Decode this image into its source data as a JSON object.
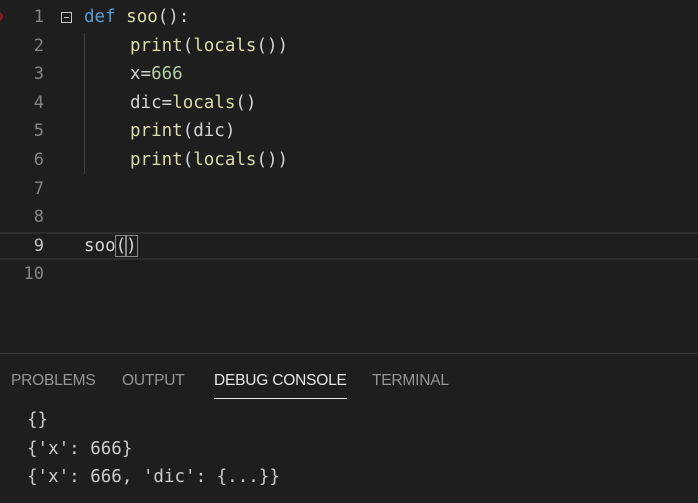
{
  "editor": {
    "lines": [
      {
        "num": "1",
        "kw": "def",
        "name": "soo",
        "rest": "():"
      },
      {
        "num": "2",
        "fn": "print",
        "rest": "(",
        "fn2": "locals",
        "rest2": "())"
      },
      {
        "num": "3",
        "a": "x=",
        "n": "666"
      },
      {
        "num": "4",
        "a": "dic=",
        "fn": "locals",
        "rest": "()"
      },
      {
        "num": "5",
        "fn": "print",
        "rest": "(dic)"
      },
      {
        "num": "6",
        "fn": "print",
        "rest": "(",
        "fn2": "locals",
        "rest2": "())"
      },
      {
        "num": "7"
      },
      {
        "num": "8"
      },
      {
        "num": "9",
        "fn": "soo",
        "open": "(",
        "close": ")"
      },
      {
        "num": "10"
      }
    ]
  },
  "panel": {
    "tabs": [
      {
        "label": "PROBLEMS"
      },
      {
        "label": "OUTPUT"
      },
      {
        "label": "DEBUG CONSOLE"
      },
      {
        "label": "TERMINAL"
      }
    ],
    "active_tab": "DEBUG CONSOLE",
    "console": [
      "{}",
      "{'x': 666}",
      "{'x': 666, 'dic': {...}}"
    ]
  }
}
